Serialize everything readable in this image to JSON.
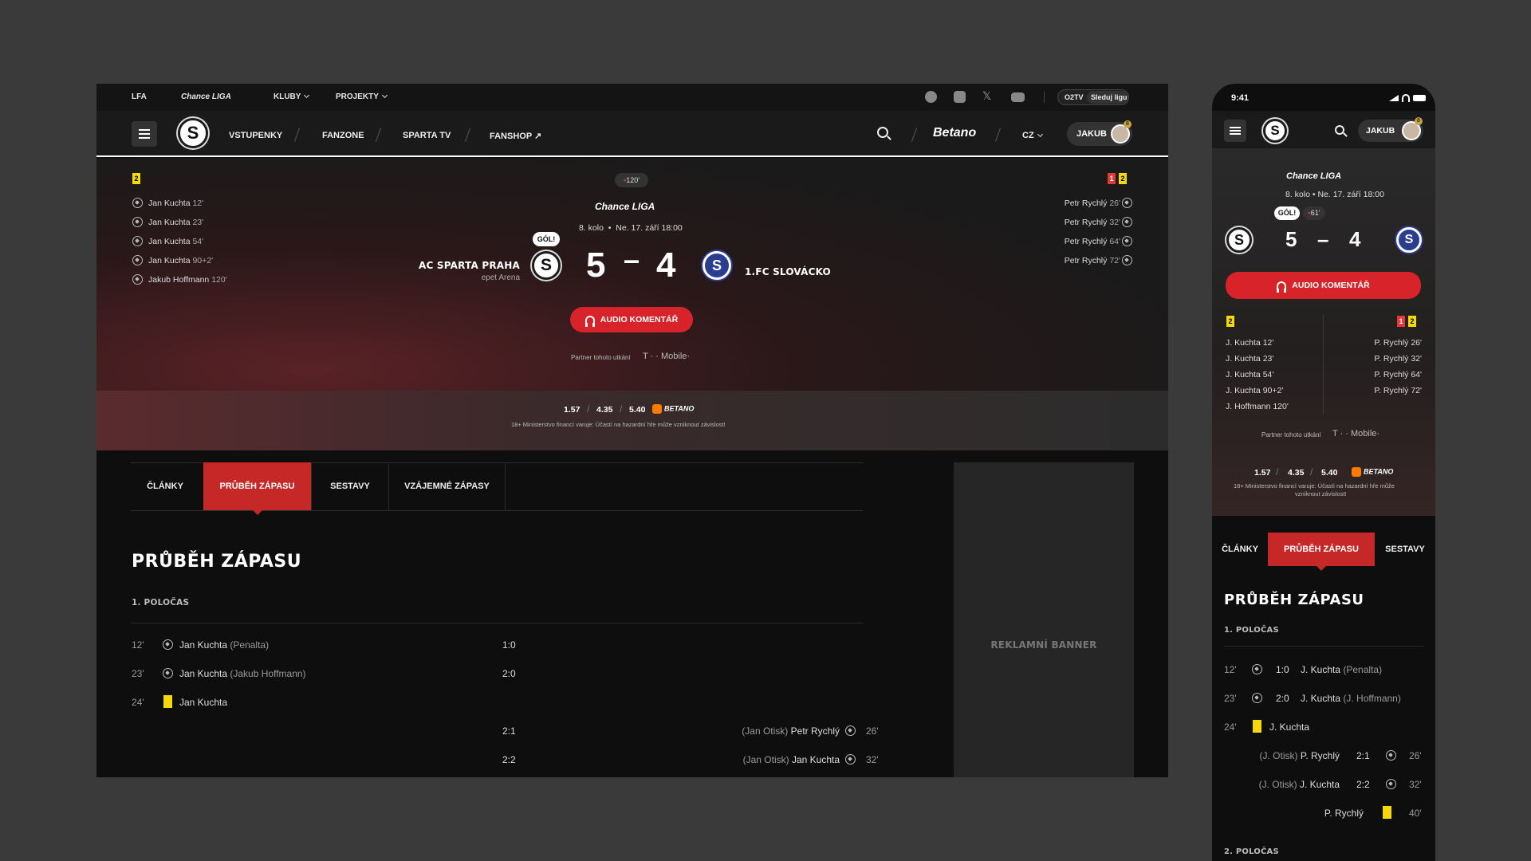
{
  "desktop": {
    "topbar": {
      "lfa": "LFA",
      "liga": "Chance LIGA",
      "kluby": "KLUBY",
      "projekty": "PROJEKTY",
      "otv": "O2TV",
      "sleduj": "Sleduj ligu"
    },
    "nav": {
      "club_letter": "S",
      "links": [
        "VSTUPENKY",
        "FANZONE",
        "SPARTA TV",
        "FANSHOP ↗"
      ],
      "betano": "Betano",
      "lang": "CZ",
      "user": "JAKUB",
      "user_badge": "8"
    },
    "match": {
      "time": "120'",
      "liga": "Chance LIGA",
      "round": "8. kolo",
      "date": "Ne. 17. září 18:00",
      "home": {
        "name": "AC SPARTA PRAHA",
        "venue": "epet Arena",
        "letter": "S",
        "score": "5"
      },
      "away": {
        "name": "1.FC SLOVÁCKO",
        "letter": "S",
        "score": "4"
      },
      "dash": "–",
      "gol_label": "GÓL!",
      "home_cards": [
        "2"
      ],
      "away_cards": [
        {
          "type": "r",
          "count": "1"
        },
        {
          "type": "y",
          "count": "2"
        }
      ],
      "home_scorers": [
        {
          "name": "Jan Kuchta",
          "min": "12'"
        },
        {
          "name": "Jan Kuchta",
          "min": "23'"
        },
        {
          "name": "Jan Kuchta",
          "min": "54'"
        },
        {
          "name": "Jan Kuchta",
          "min": "90+2'"
        },
        {
          "name": "Jakub Hoffmann",
          "min": "120'"
        }
      ],
      "away_scorers": [
        {
          "name": "Petr Rychlý",
          "min": "26'"
        },
        {
          "name": "Petr Rychlý",
          "min": "32'"
        },
        {
          "name": "Petr Rychlý",
          "min": "64'"
        },
        {
          "name": "Petr Rychlý",
          "min": "72'"
        }
      ],
      "audio_label": "AUDIO KOMENTÁŘ",
      "partner": "Partner tohoto utkání",
      "partner_brand": "T · · Mobile·",
      "odds": [
        "1.57",
        "4.35",
        "5.40"
      ],
      "odds_brand": "BETANO",
      "disclaimer": "18+ Ministerstvo financí varuje: Účastí na hazardní hře může vzniknout závislost!"
    },
    "tabs": [
      "ČLÁNKY",
      "PRŮBĚH ZÁPASU",
      "SESTAVY",
      "VZÁJEMNÉ ZÁPASY"
    ],
    "content": {
      "title": "PRŮBĚH ZÁPASU",
      "half1": "1. POLOČAS",
      "events": [
        {
          "min": "12'",
          "name": "Jan Kuchta",
          "extra": "(Penalta)",
          "score": "1:0"
        },
        {
          "min": "23'",
          "name": "Jan Kuchta",
          "extra": "(Jakub Hoffmann)",
          "score": "2:0"
        },
        {
          "min": "24'",
          "name": "Jan Kuchta",
          "extra": "",
          "score": ""
        },
        {
          "min": "26'",
          "name": "Petr Rychlý",
          "extra": "(Jan Otisk)",
          "score": "2:1"
        },
        {
          "min": "32'",
          "name": "Jan Kuchta",
          "extra": "(Jan Otisk)",
          "score": "2:2"
        }
      ],
      "banner": "REKLAMNÍ BANNER"
    }
  },
  "mobile": {
    "status_time": "9:41",
    "user": "JAKUB",
    "liga": "Chance LIGA",
    "round": "8. kolo",
    "date": "Ne. 17. září 18:00",
    "gol_label": "GÓL!",
    "time": "61'",
    "home_score": "5",
    "away_score": "4",
    "dash": "–",
    "audio_label": "AUDIO KOMENTÁŘ",
    "home_scorers": [
      "J. Kuchta 12'",
      "J. Kuchta 23'",
      "J. Kuchta 54'",
      "J. Kuchta 90+2'",
      "J. Hoffmann 120'"
    ],
    "away_scorers": [
      "P. Rychlý 26'",
      "P. Rychlý 32'",
      "P. Rychlý 64'",
      "P. Rychlý 72'"
    ],
    "partner": "Partner tohoto utkání",
    "partner_brand": "T · · Mobile·",
    "odds": [
      "1.57",
      "4.35",
      "5.40"
    ],
    "odds_brand": "BETANO",
    "disclaimer1": "18+ Ministerstvo financí varuje: Účastí na hazardní hře může",
    "disclaimer2": "vzniknout závislost!",
    "tabs": [
      "ČLÁNKY",
      "PRŮBĚH ZÁPASU",
      "SESTAVY"
    ],
    "title": "PRŮBĚH ZÁPASU",
    "half1": "1. POLOČAS",
    "half2": "2. POLOČAS",
    "events": [
      {
        "min": "12'",
        "score": "1:0",
        "name": "J. Kuchta",
        "extra": "(Penalta)"
      },
      {
        "min": "23'",
        "score": "2:0",
        "name": "J. Kuchta",
        "extra": "(J. Hoffmann)"
      },
      {
        "min": "24'",
        "name": "J. Kuchta"
      },
      {
        "min": "26'",
        "score": "2:1",
        "name": "P. Rychlý",
        "extra": "(J. Otisk)"
      },
      {
        "min": "32'",
        "score": "2:2",
        "name": "J. Kuchta",
        "extra": "(J. Otisk)"
      },
      {
        "min": "40'",
        "name": "P. Rychlý"
      }
    ]
  }
}
